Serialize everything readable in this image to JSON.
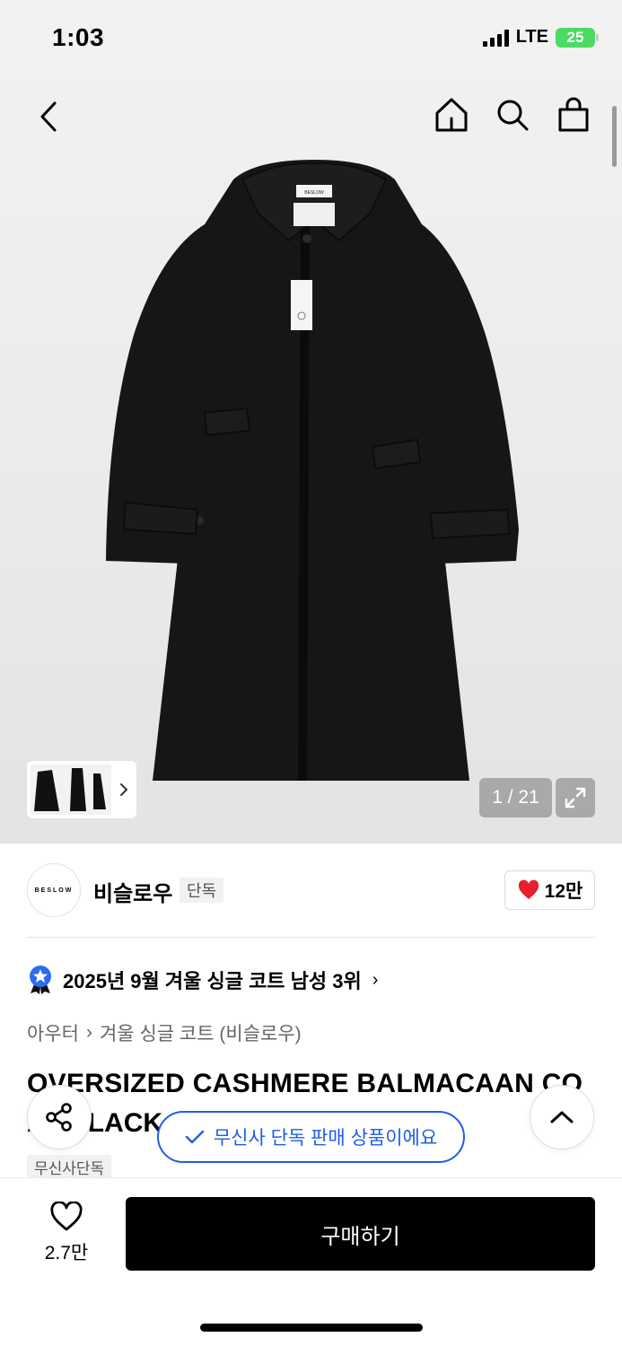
{
  "status_bar": {
    "time": "1:03",
    "network": "LTE",
    "battery": "25"
  },
  "header": {
    "back_icon": "chevron-left-icon",
    "icons": [
      "home-icon",
      "search-icon",
      "shopping-bag-icon"
    ]
  },
  "gallery": {
    "current": "1 / 21",
    "expand_icon": "expand-icon",
    "coat_label_text": "BESLOW"
  },
  "brand": {
    "logo_text": "BESLOW",
    "name": "비슬로우",
    "badge": "단독",
    "likes": "12만",
    "like_color": "#e8202c"
  },
  "ranking": {
    "text": "2025년 9월 겨울 싱글 코트 남성 3위",
    "arrow": "›",
    "badge_color": "#2b6cf0"
  },
  "breadcrumb": {
    "items": [
      "아우터",
      "겨울 싱글 코트 (비슬로우)"
    ],
    "separator": "›"
  },
  "product": {
    "title_line1": "OVERSIZED CASHMERE BALMACAAN CO",
    "title_line2": "AT BLACK",
    "tag": "무신사단독"
  },
  "toast": {
    "text": "무신사 단독 판매 상품이에요",
    "color": "#1e5ee8"
  },
  "bottom_bar": {
    "wish_count": "2.7만",
    "buy_label": "구매하기"
  }
}
